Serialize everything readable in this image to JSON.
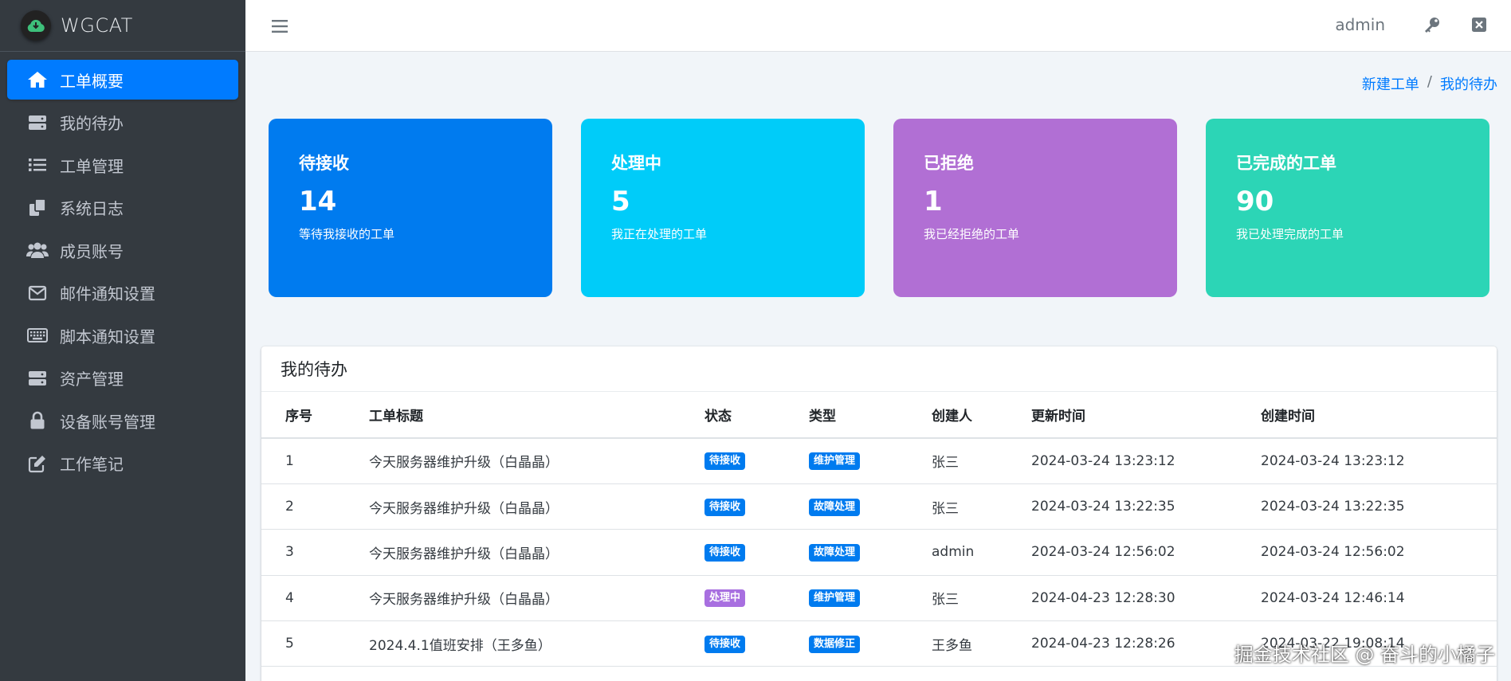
{
  "brand": {
    "name": "WGCAT",
    "logo_icon": "cloud-icon"
  },
  "sidebar": {
    "items": [
      {
        "label": "工单概要",
        "icon": "home-icon",
        "active": true
      },
      {
        "label": "我的待办",
        "icon": "server-icon"
      },
      {
        "label": "工单管理",
        "icon": "list-icon"
      },
      {
        "label": "系统日志",
        "icon": "copy-icon"
      },
      {
        "label": "成员账号",
        "icon": "users-icon"
      },
      {
        "label": "邮件通知设置",
        "icon": "envelope-icon"
      },
      {
        "label": "脚本通知设置",
        "icon": "keyboard-icon"
      },
      {
        "label": "资产管理",
        "icon": "server-icon"
      },
      {
        "label": "设备账号管理",
        "icon": "lock-icon"
      },
      {
        "label": "工作笔记",
        "icon": "edit-icon"
      }
    ]
  },
  "header": {
    "user": "admin"
  },
  "breadcrumb": {
    "items": [
      "新建工单",
      "我的待办"
    ],
    "separator": "/"
  },
  "cards": [
    {
      "title": "待接收",
      "value": "14",
      "desc": "等待我接收的工单",
      "color": "#007bef"
    },
    {
      "title": "处理中",
      "value": "5",
      "desc": "我正在处理的工单",
      "color": "#00ccf9"
    },
    {
      "title": "已拒绝",
      "value": "1",
      "desc": "我已经拒绝的工单",
      "color": "#b16fd4"
    },
    {
      "title": "已完成的工单",
      "value": "90",
      "desc": "我已处理完成的工单",
      "color": "#2cd5b6"
    }
  ],
  "todo": {
    "title": "我的待办",
    "columns": [
      "序号",
      "工单标题",
      "状态",
      "类型",
      "创建人",
      "更新时间",
      "创建时间"
    ],
    "rows": [
      {
        "no": "1",
        "title": "今天服务器维护升级（白晶晶）",
        "status": "待接收",
        "type": "维护管理",
        "creator": "张三",
        "updated": "2024-03-24 13:23:12",
        "created": "2024-03-24 13:23:12"
      },
      {
        "no": "2",
        "title": "今天服务器维护升级（白晶晶）",
        "status": "待接收",
        "type": "故障处理",
        "creator": "张三",
        "updated": "2024-03-24 13:22:35",
        "created": "2024-03-24 13:22:35"
      },
      {
        "no": "3",
        "title": "今天服务器维护升级（白晶晶）",
        "status": "待接收",
        "type": "故障处理",
        "creator": "admin",
        "updated": "2024-03-24 12:56:02",
        "created": "2024-03-24 12:56:02"
      },
      {
        "no": "4",
        "title": "今天服务器维护升级（白晶晶）",
        "status": "处理中",
        "type": "维护管理",
        "creator": "张三",
        "updated": "2024-04-23 12:28:30",
        "created": "2024-03-24 12:46:14"
      },
      {
        "no": "5",
        "title": "2024.4.1值班安排（王多鱼）",
        "status": "待接收",
        "type": "数据修正",
        "creator": "王多鱼",
        "updated": "2024-04-23 12:28:26",
        "created": "2024-03-22 19:08:14"
      }
    ]
  },
  "status_colors": {
    "待接收": "#007bef",
    "处理中": "#a86fe0"
  },
  "type_color": "#007bef",
  "watermark": "掘金技术社区 @ 奋斗的小橘子"
}
